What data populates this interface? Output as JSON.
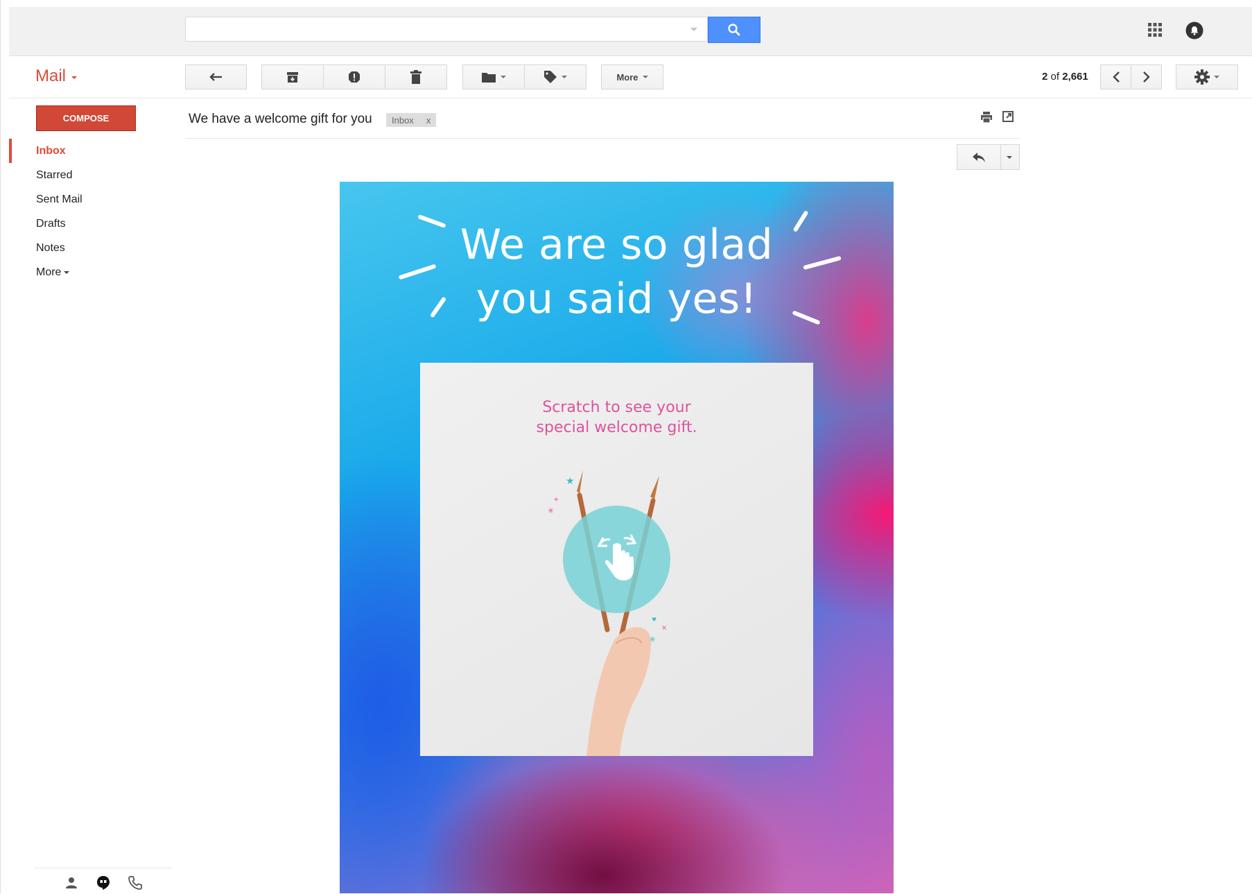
{
  "search": {
    "value": "",
    "placeholder": ""
  },
  "header": {
    "app_title": "Mail"
  },
  "toolbar": {
    "more_label": "More",
    "pager_current": "2",
    "pager_of": "of",
    "pager_total": "2,661"
  },
  "sidebar": {
    "compose_label": "COMPOSE",
    "items": [
      {
        "label": "Inbox",
        "active": true
      },
      {
        "label": "Starred"
      },
      {
        "label": "Sent Mail"
      },
      {
        "label": "Drafts"
      },
      {
        "label": "Notes"
      },
      {
        "label": "More"
      }
    ]
  },
  "message": {
    "subject": "We have a welcome gift for you",
    "label_chip": "Inbox",
    "label_remove": "x"
  },
  "email_body": {
    "headline_line1": "We are so glad",
    "headline_line2": "you said yes!",
    "scratch_line1": "Scratch to see your",
    "scratch_line2": "special welcome gift."
  },
  "colors": {
    "accent_red": "#dd4b39",
    "compose_red": "#d14836",
    "search_blue": "#4d90fe",
    "scratch_pink": "#e0529a",
    "touch_teal": "#78d2d7"
  },
  "icons": [
    "search-icon",
    "apps-grid-icon",
    "notifications-icon",
    "back-arrow-icon",
    "archive-icon",
    "report-spam-icon",
    "trash-icon",
    "folder-icon",
    "tag-icon",
    "chevron-left-icon",
    "chevron-right-icon",
    "gear-icon",
    "print-icon",
    "new-window-icon",
    "reply-icon",
    "contacts-icon",
    "hangouts-icon",
    "phone-icon",
    "touch-gesture-icon"
  ]
}
